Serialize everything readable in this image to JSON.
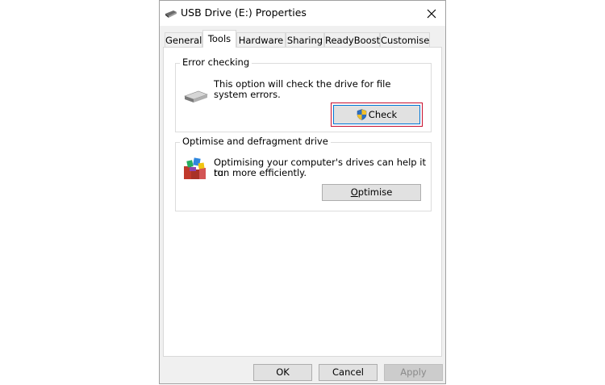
{
  "window": {
    "title": "USB Drive (E:) Properties",
    "close_label": "×"
  },
  "tabs": [
    {
      "label": "General"
    },
    {
      "label": "Tools"
    },
    {
      "label": "Hardware"
    },
    {
      "label": "Sharing"
    },
    {
      "label": "ReadyBoost"
    },
    {
      "label": "Customise"
    }
  ],
  "active_tab": "Tools",
  "error_checking": {
    "heading": "Error checking",
    "line1": "This option will check the drive for file",
    "line2": "system errors.",
    "button_label": "Check",
    "icon": "shield-icon"
  },
  "optimise": {
    "heading": "Optimise and defragment drive",
    "line1": "Optimising your computer's drives can help it to",
    "line2": "run more efficiently.",
    "button_label_underlined": "O",
    "button_label_rest": "ptimise",
    "icon": "defragment-icon"
  },
  "footer": {
    "ok": "OK",
    "cancel": "Cancel",
    "apply": "Apply"
  },
  "colors": {
    "focus": "#c8102e",
    "accent": "#0078d7"
  }
}
